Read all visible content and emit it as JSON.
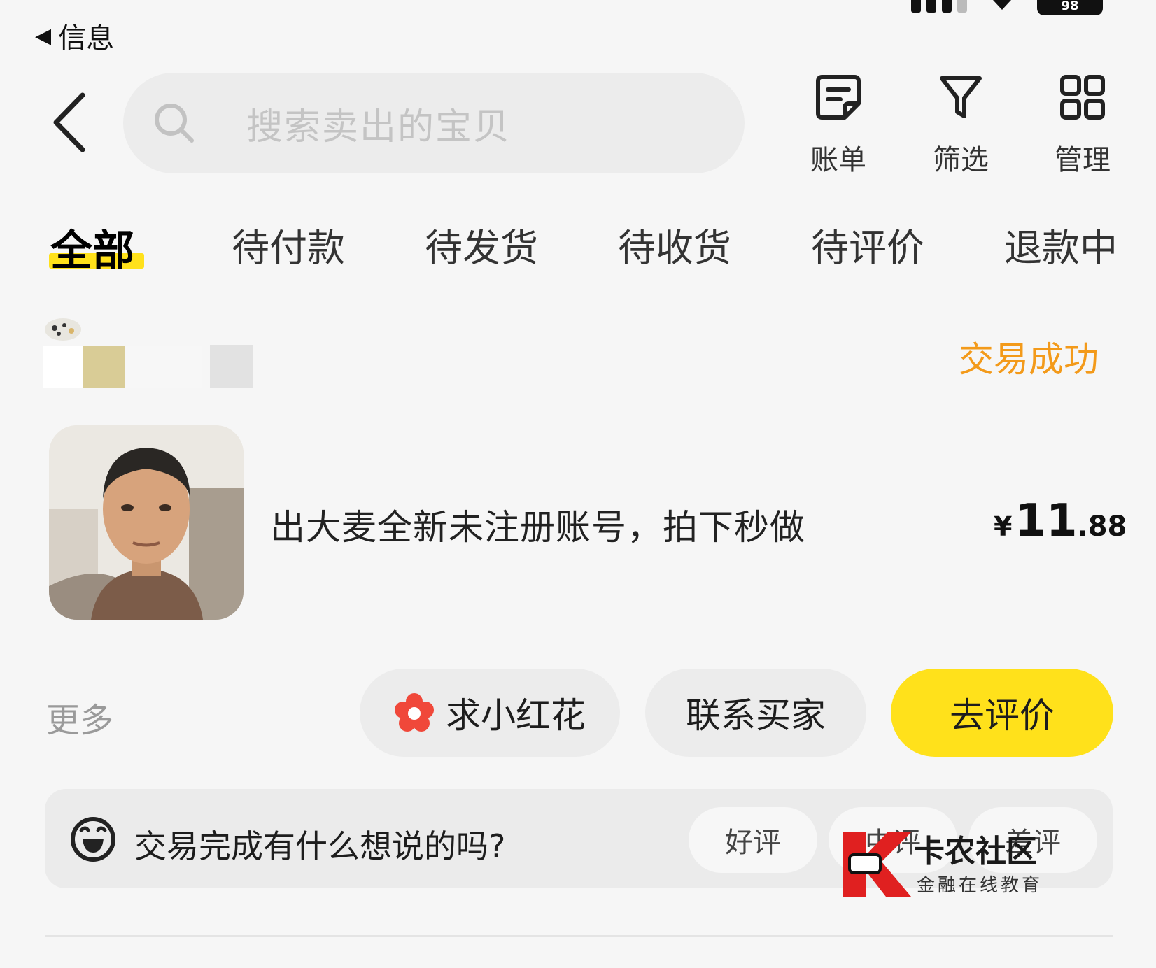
{
  "status_bar": {
    "back_label": "信息",
    "battery": "98"
  },
  "header": {
    "search_placeholder": "搜索卖出的宝贝",
    "actions": [
      {
        "label": "账单",
        "icon": "bill-icon"
      },
      {
        "label": "筛选",
        "icon": "filter-icon"
      },
      {
        "label": "管理",
        "icon": "grid-icon"
      }
    ]
  },
  "tabs": [
    {
      "label": "全部",
      "active": true
    },
    {
      "label": "待付款"
    },
    {
      "label": "待发货"
    },
    {
      "label": "待收货"
    },
    {
      "label": "待评价"
    },
    {
      "label": "退款中"
    }
  ],
  "order": {
    "status": "交易成功",
    "product_title": "出大麦全新未注册账号，拍下秒做",
    "price": {
      "currency": "¥",
      "integer": "11",
      "decimal": ".88"
    },
    "more_label": "更多",
    "buttons": {
      "flower": "求小红花",
      "contact": "联系买家",
      "review": "去评价"
    }
  },
  "feedback": {
    "prompt": "交易完成有什么想说的吗?",
    "options": [
      "好评",
      "中评",
      "差评"
    ]
  },
  "watermark": {
    "title": "卡农社区",
    "subtitle": "金融在线教育"
  },
  "colors": {
    "accent_yellow": "#ffe11b",
    "status_orange": "#f39a1a",
    "watermark_red": "#e02020"
  }
}
